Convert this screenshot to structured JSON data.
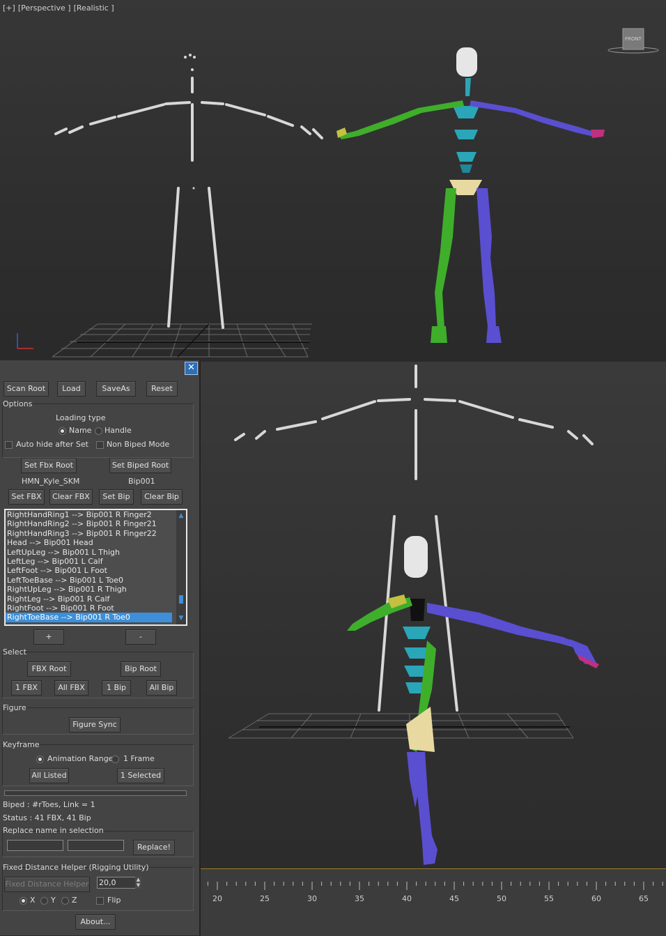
{
  "viewport_top": {
    "label_parts": [
      "[+]",
      "[Perspective ]",
      "[Realistic ]"
    ],
    "viewcube_label": "FRONT"
  },
  "panel": {
    "buttons_top": [
      "Scan Root",
      "Load",
      "SaveAs",
      "Reset"
    ],
    "options_title": "Options",
    "loading_type_label": "Loading type",
    "loading_type_options": [
      "Name",
      "Handle"
    ],
    "auto_hide_label": "Auto hide after Set",
    "non_biped_label": "Non Biped Mode",
    "set_fbx_root": "Set Fbx Root",
    "set_biped_root": "Set Biped Root",
    "fbx_root_value": "HMN_Kyle_SKM",
    "biped_root_value": "Bip001",
    "set_fbx": "Set FBX",
    "clear_fbx": "Clear FBX",
    "set_bip": "Set Bip",
    "clear_bip": "Clear Bip",
    "mapping_list": [
      "RightHandRing1 --> Bip001 R Finger2",
      "RightHandRing2 --> Bip001 R Finger21",
      "RightHandRing3 --> Bip001 R Finger22",
      "Head --> Bip001 Head",
      "LeftUpLeg --> Bip001 L Thigh",
      "LeftLeg --> Bip001 L Calf",
      "LeftFoot --> Bip001 L Foot",
      "LeftToeBase --> Bip001 L Toe0",
      "RightUpLeg --> Bip001 R Thigh",
      "RightLeg --> Bip001 R Calf",
      "RightFoot --> Bip001 R Foot",
      "RightToeBase --> Bip001 R Toe0"
    ],
    "selected_index": 11,
    "add_label": "+",
    "remove_label": "-",
    "select_title": "Select",
    "fbx_root_btn": "FBX Root",
    "bip_root_btn": "Bip Root",
    "select_buttons": [
      "1 FBX",
      "All FBX",
      "1 Bip",
      "All Bip"
    ],
    "figure_title": "Figure",
    "figure_sync": "Figure Sync",
    "keyframe_title": "Keyframe",
    "anim_range_label": "Animation Range",
    "one_frame_label": "1 Frame",
    "all_listed": "All Listed",
    "one_selected": "1 Selected",
    "biped_status": "Biped : #rToes, Link = 1",
    "status_line": "Status : 41 FBX, 41 Bip",
    "replace_title": "Replace name in selection",
    "replace_button": "Replace!",
    "helper_title": "Fixed Distance Helper (Rigging Utility)",
    "helper_button": "Fixed Distance Helper",
    "helper_value": "20,0",
    "axis_labels": [
      "X",
      "Y",
      "Z"
    ],
    "flip_label": "Flip",
    "about_button": "About..."
  },
  "timeline": {
    "ticks": [
      "20",
      "25",
      "30",
      "35",
      "40",
      "45",
      "50",
      "55",
      "60",
      "65"
    ]
  },
  "colors": {
    "biped_green": "#3fae2b",
    "biped_blue": "#5a4fd0",
    "biped_cyan": "#2aa6b8",
    "selection_blue": "#3c8fd8",
    "timeline_accent": "#a07a2c"
  }
}
